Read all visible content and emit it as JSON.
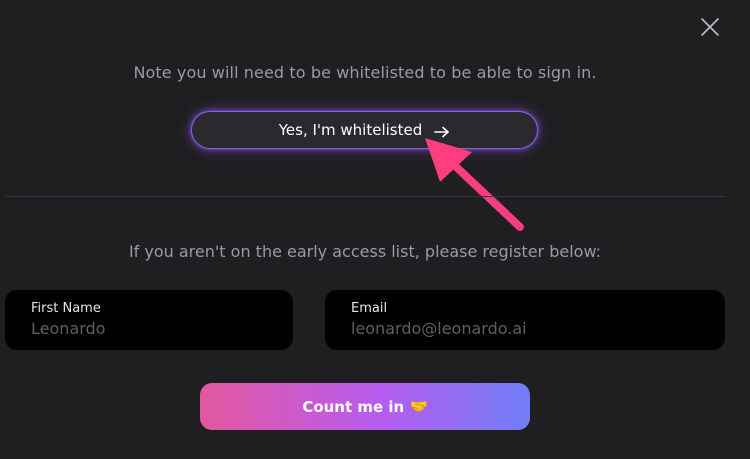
{
  "dialog": {
    "note": "Note you will need to be whitelisted to be able to sign in.",
    "whitelisted_button": "Yes, I'm whitelisted",
    "register_text": "If you aren't on the early access list, please register below:",
    "cta_label": "Count me in",
    "cta_emoji": "🤝",
    "close_icon": "close-icon",
    "accent_color": "#8a5cf0",
    "pointer_color": "#ff3d7f"
  },
  "form": {
    "first_name": {
      "label": "First Name",
      "placeholder": "Leonardo",
      "value": ""
    },
    "email": {
      "label": "Email",
      "placeholder": "leonardo@leonardo.ai",
      "value": ""
    }
  }
}
